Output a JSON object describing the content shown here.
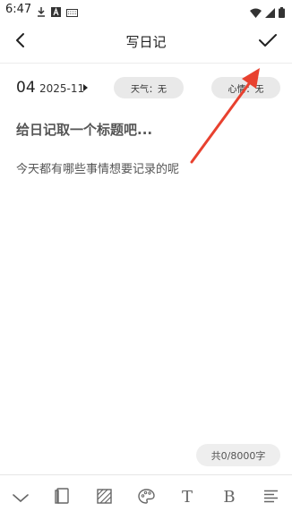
{
  "status_bar": {
    "time": "6:47",
    "icons": [
      "download-icon",
      "font-icon",
      "keyboard-icon",
      "wifi-icon",
      "signal-icon",
      "battery-icon"
    ]
  },
  "app_bar": {
    "title": "写日记",
    "back_icon": "back-arrow-icon",
    "confirm_icon": "check-icon"
  },
  "date": {
    "day": "04",
    "year_month": "2025-11"
  },
  "chips": {
    "weather": "天气：无",
    "mood": "心情：无"
  },
  "editor": {
    "title_placeholder": "给日记取一个标题吧...",
    "body_placeholder": "今天都有哪些事情想要记录的呢"
  },
  "counter": "共0/8000字",
  "toolbar": {
    "items": [
      "collapse-icon",
      "template-icon",
      "background-icon",
      "palette-icon",
      "text-icon",
      "bold-icon",
      "align-icon"
    ],
    "text_label": "T",
    "bold_label": "B"
  },
  "colors": {
    "accent_arrow": "#e8412f",
    "chip_bg": "#e9e9e9"
  }
}
